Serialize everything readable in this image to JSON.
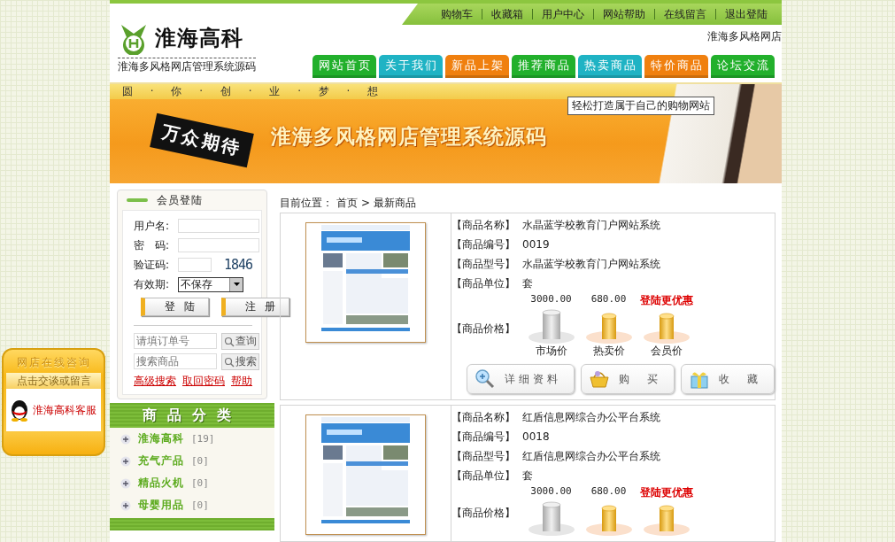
{
  "top_links": [
    "购物车",
    "收藏箱",
    "用户中心",
    "网站帮助",
    "在线留言",
    "退出登陆"
  ],
  "logo": {
    "name": "淮海高科",
    "subtitle": "淮海多风格网店管理系统源码"
  },
  "marquee_text": "淮海多风格网店",
  "nav_tabs": [
    {
      "label": "网站首页",
      "color": "#22b02c"
    },
    {
      "label": "关于我们",
      "color": "#1fb3c4"
    },
    {
      "label": "新品上架",
      "color": "#f0800f"
    },
    {
      "label": "推荐商品",
      "color": "#22b02c"
    },
    {
      "label": "热卖商品",
      "color": "#1fb3c4"
    },
    {
      "label": "特价商品",
      "color": "#f0800f"
    },
    {
      "label": "论坛交流",
      "color": "#22b02c"
    }
  ],
  "banner": {
    "slogan": "圆 · 你 · 创 · 业 · 梦 · 想",
    "tooltip": "轻松打造属于自己的购物网站",
    "badge": "万众期待",
    "title": "淮海多风格网店管理系统源码"
  },
  "login": {
    "title": "会员登陆",
    "fields": [
      {
        "label": "用户名:",
        "kind": "text"
      },
      {
        "label": "密　码:",
        "kind": "password"
      },
      {
        "label": "验证码:",
        "kind": "captcha",
        "captcha": "1846"
      },
      {
        "label": "有效期:",
        "kind": "select",
        "value": "不保存"
      }
    ],
    "buttons": [
      "登 陆",
      "注 册"
    ],
    "order_search": {
      "placeholder": "请填订单号",
      "button": "查询"
    },
    "product_search": {
      "placeholder": "搜索商品",
      "button": "搜索"
    },
    "links": [
      "高级搜索",
      "取回密码",
      "帮助"
    ]
  },
  "categories": {
    "title": "商品分类",
    "items": [
      {
        "name": "淮海高科",
        "count": "[19]"
      },
      {
        "name": "充气产品",
        "count": "[0]"
      },
      {
        "name": "精品火机",
        "count": "[0]"
      },
      {
        "name": "母婴用品",
        "count": "[0]"
      }
    ]
  },
  "breadcrumb": {
    "label": "目前位置：",
    "items": [
      "首页",
      "最新商品"
    ],
    "separator": ">"
  },
  "products": [
    {
      "fields": [
        {
          "label": "【商品名称】",
          "value": "水晶蓝学校教育门户网站系统"
        },
        {
          "label": "【商品编号】",
          "value": "0019"
        },
        {
          "label": "【商品型号】",
          "value": "水晶蓝学校教育门户网站系统"
        },
        {
          "label": "【商品单位】",
          "value": "套"
        }
      ],
      "price_label": "【商品价格】",
      "prices": [
        {
          "kind": "market",
          "amount": "3000.00",
          "label": "市场价"
        },
        {
          "kind": "hot",
          "amount": "680.00",
          "label": "热卖价"
        },
        {
          "kind": "member",
          "amount": "登陆更优惠",
          "label": "会员价"
        }
      ],
      "buttons": [
        {
          "kind": "details",
          "label": "详细资料"
        },
        {
          "kind": "buy",
          "label": "购　买"
        },
        {
          "kind": "favorite",
          "label": "收　藏"
        }
      ]
    },
    {
      "fields": [
        {
          "label": "【商品名称】",
          "value": "红盾信息网综合办公平台系统"
        },
        {
          "label": "【商品编号】",
          "value": "0018"
        },
        {
          "label": "【商品型号】",
          "value": "红盾信息网综合办公平台系统"
        },
        {
          "label": "【商品单位】",
          "value": "套"
        }
      ],
      "price_label": "【商品价格】",
      "prices": [
        {
          "kind": "market",
          "amount": "3000.00"
        },
        {
          "kind": "hot",
          "amount": "680.00"
        },
        {
          "kind": "member",
          "amount": "登陆更优惠"
        }
      ]
    }
  ],
  "consult": {
    "title": "网店在线咨询",
    "subtitle": "点击交谈或留言",
    "service": "淮海高科客服"
  }
}
